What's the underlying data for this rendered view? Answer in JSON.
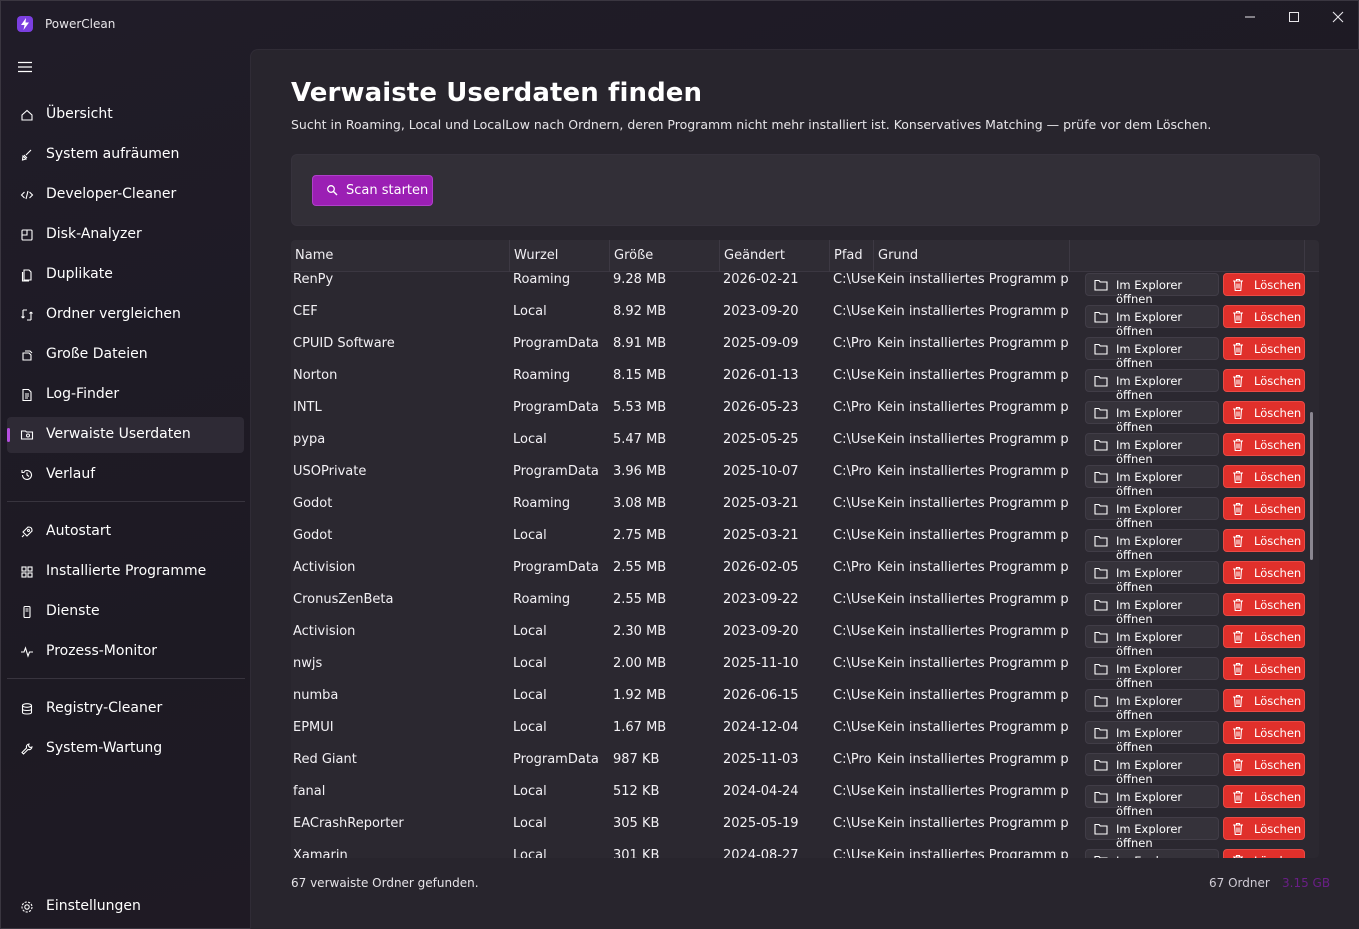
{
  "app": {
    "title": "PowerClean",
    "accent": "#9b1fb4",
    "danger": "#e0302b"
  },
  "window_controls": {
    "minimize_icon": "minimize-icon",
    "maximize_icon": "maximize-icon",
    "close_icon": "close-icon"
  },
  "sidebar": {
    "items": [
      {
        "label": "Übersicht",
        "icon": "home-icon"
      },
      {
        "label": "System aufräumen",
        "icon": "broom-icon"
      },
      {
        "label": "Developer-Cleaner",
        "icon": "code-icon"
      },
      {
        "label": "Disk-Analyzer",
        "icon": "disk-icon"
      },
      {
        "label": "Duplikate",
        "icon": "duplicate-icon"
      },
      {
        "label": "Ordner vergleichen",
        "icon": "compare-icon"
      },
      {
        "label": "Große Dateien",
        "icon": "large-files-icon"
      },
      {
        "label": "Log-Finder",
        "icon": "document-icon"
      },
      {
        "label": "Verwaiste Userdaten",
        "icon": "folder-search-icon",
        "active": true
      },
      {
        "label": "Verlauf",
        "icon": "history-icon"
      },
      {
        "label": "Autostart",
        "icon": "rocket-icon"
      },
      {
        "label": "Installierte Programme",
        "icon": "apps-icon"
      },
      {
        "label": "Dienste",
        "icon": "services-icon"
      },
      {
        "label": "Prozess-Monitor",
        "icon": "pulse-icon"
      },
      {
        "label": "Registry-Cleaner",
        "icon": "registry-icon"
      },
      {
        "label": "System-Wartung",
        "icon": "wrench-icon"
      }
    ],
    "settings_label": "Einstellungen"
  },
  "page": {
    "title": "Verwaiste Userdaten finden",
    "subtitle": "Sucht in Roaming, Local und LocalLow nach Ordnern, deren Programm nicht mehr installiert ist. Konservatives Matching — prüfe vor dem Löschen.",
    "scan_button": "Scan starten"
  },
  "table": {
    "columns": [
      "Name",
      "Wurzel",
      "Größe",
      "Geändert",
      "Pfad",
      "Grund"
    ],
    "open_label": "Im Explorer öffnen",
    "delete_label": "Löschen",
    "rows": [
      {
        "name": "RenPy",
        "root": "Roaming",
        "size": "9.28 MB",
        "date": "2026-02-21",
        "path": "C:\\Use",
        "reason": "Kein installiertes Programm pas"
      },
      {
        "name": "CEF",
        "root": "Local",
        "size": "8.92 MB",
        "date": "2023-09-20",
        "path": "C:\\Use",
        "reason": "Kein installiertes Programm pas"
      },
      {
        "name": "CPUID Software",
        "root": "ProgramData",
        "size": "8.91 MB",
        "date": "2025-09-09",
        "path": "C:\\Pro",
        "reason": "Kein installiertes Programm pas"
      },
      {
        "name": "Norton",
        "root": "Roaming",
        "size": "8.15 MB",
        "date": "2026-01-13",
        "path": "C:\\Use",
        "reason": "Kein installiertes Programm pas"
      },
      {
        "name": "INTL",
        "root": "ProgramData",
        "size": "5.53 MB",
        "date": "2026-05-23",
        "path": "C:\\Pro",
        "reason": "Kein installiertes Programm pas"
      },
      {
        "name": "pypa",
        "root": "Local",
        "size": "5.47 MB",
        "date": "2025-05-25",
        "path": "C:\\Use",
        "reason": "Kein installiertes Programm pas"
      },
      {
        "name": "USOPrivate",
        "root": "ProgramData",
        "size": "3.96 MB",
        "date": "2025-10-07",
        "path": "C:\\Pro",
        "reason": "Kein installiertes Programm pas"
      },
      {
        "name": "Godot",
        "root": "Roaming",
        "size": "3.08 MB",
        "date": "2025-03-21",
        "path": "C:\\Use",
        "reason": "Kein installiertes Programm pas"
      },
      {
        "name": "Godot",
        "root": "Local",
        "size": "2.75 MB",
        "date": "2025-03-21",
        "path": "C:\\Use",
        "reason": "Kein installiertes Programm pas"
      },
      {
        "name": "Activision",
        "root": "ProgramData",
        "size": "2.55 MB",
        "date": "2026-02-05",
        "path": "C:\\Pro",
        "reason": "Kein installiertes Programm pas"
      },
      {
        "name": "CronusZenBeta",
        "root": "Roaming",
        "size": "2.55 MB",
        "date": "2023-09-22",
        "path": "C:\\Use",
        "reason": "Kein installiertes Programm pas"
      },
      {
        "name": "Activision",
        "root": "Local",
        "size": "2.30 MB",
        "date": "2023-09-20",
        "path": "C:\\Use",
        "reason": "Kein installiertes Programm pas"
      },
      {
        "name": "nwjs",
        "root": "Local",
        "size": "2.00 MB",
        "date": "2025-11-10",
        "path": "C:\\Use",
        "reason": "Kein installiertes Programm pas"
      },
      {
        "name": "numba",
        "root": "Local",
        "size": "1.92 MB",
        "date": "2026-06-15",
        "path": "C:\\Use",
        "reason": "Kein installiertes Programm pas"
      },
      {
        "name": "EPMUI",
        "root": "Local",
        "size": "1.67 MB",
        "date": "2024-12-04",
        "path": "C:\\Use",
        "reason": "Kein installiertes Programm pas"
      },
      {
        "name": "Red Giant",
        "root": "ProgramData",
        "size": "987 KB",
        "date": "2025-11-03",
        "path": "C:\\Pro",
        "reason": "Kein installiertes Programm pas"
      },
      {
        "name": "fanal",
        "root": "Local",
        "size": "512 KB",
        "date": "2024-04-24",
        "path": "C:\\Use",
        "reason": "Kein installiertes Programm pas"
      },
      {
        "name": "EACrashReporter",
        "root": "Local",
        "size": "305 KB",
        "date": "2025-05-19",
        "path": "C:\\Use",
        "reason": "Kein installiertes Programm pas"
      },
      {
        "name": "Xamarin",
        "root": "Local",
        "size": "301 KB",
        "date": "2024-08-27",
        "path": "C:\\Use",
        "reason": "Kein installiertes Programm pas"
      }
    ]
  },
  "status": {
    "found_text": "67 verwaiste Ordner gefunden.",
    "count_text": "67  Ordner",
    "size_text": "3.15 GB"
  }
}
